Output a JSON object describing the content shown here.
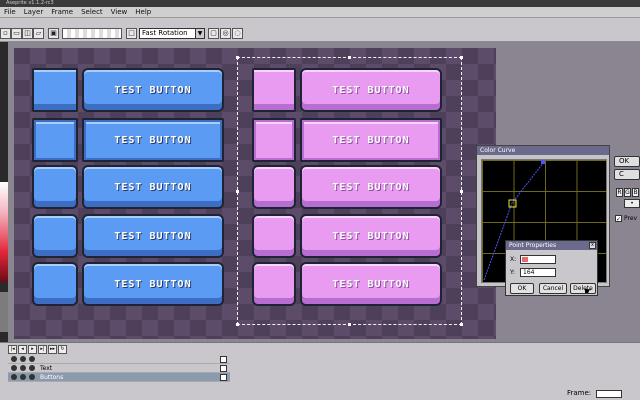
{
  "window": {
    "title": "Aseprite v1.1.2-rc3"
  },
  "menu": [
    "File",
    "Layer",
    "Frame",
    "Select",
    "View",
    "Help"
  ],
  "toolbar": {
    "rotation_algorithm": "Fast Rotation"
  },
  "canvas": {
    "button_label": "TEST BUTTON",
    "rows": 5
  },
  "color_curve": {
    "title": "Color Curve",
    "ok": "OK",
    "cancel": "C",
    "preview": "Prev"
  },
  "point_properties": {
    "title": "Point Properties",
    "x_label": "X:",
    "y_label": "Y:",
    "x_value": "",
    "y_value": "164",
    "ok": "OK",
    "cancel": "Cancel",
    "delete": "Delete"
  },
  "layers": [
    {
      "name": "",
      "selected": false
    },
    {
      "name": "Text",
      "selected": false
    },
    {
      "name": "Buttons",
      "selected": true
    }
  ],
  "statusbar": {
    "frame_label": "Frame:",
    "frame_value": ""
  },
  "colors": {
    "blue_button": "#5b9bf3",
    "pink_button": "#e99af1",
    "canvas_bg": "#4e3f5b"
  }
}
